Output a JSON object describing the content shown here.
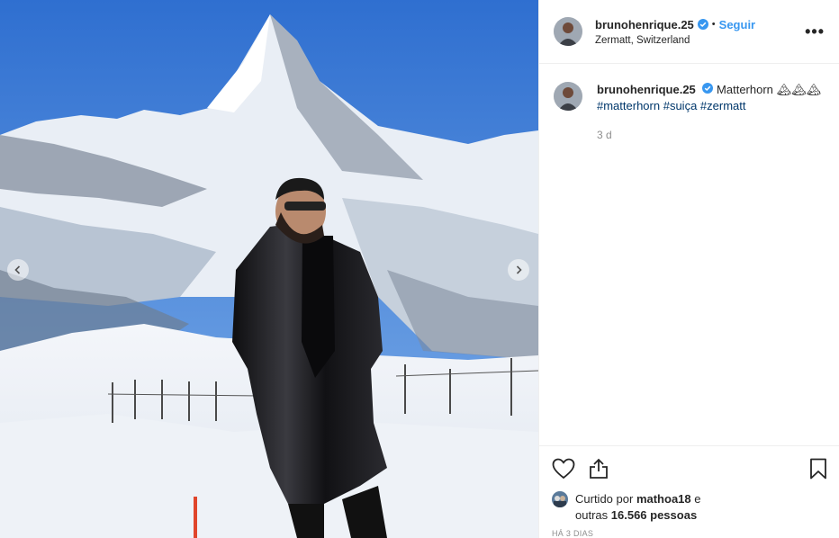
{
  "post": {
    "username": "brunohenrique.25",
    "follow_label": "Seguir",
    "dot": "•",
    "location": "Zermatt, Switzerland",
    "more_label": "•••",
    "caption": {
      "username": "brunohenrique.25",
      "text": "Matterhorn 🏔🏔🏔",
      "tags": [
        "#matterhorn",
        "#suiça",
        "#zermatt"
      ],
      "time": "3 d"
    },
    "liked_by": {
      "prefix": "Curtido por",
      "user": "mathoa18",
      "conj": "e",
      "others_prefix": "outras",
      "others": "16.566 pessoas"
    },
    "time_ago": "HÁ 3 DIAS",
    "colors": {
      "link": "#3897f0",
      "hashtag": "#00376b",
      "verified": "#3897f0",
      "muted": "#8e8e8e"
    },
    "icons": [
      "heart-icon",
      "share-icon",
      "bookmark-icon",
      "chevron-left-icon",
      "chevron-right-icon",
      "verified-badge-icon"
    ]
  }
}
